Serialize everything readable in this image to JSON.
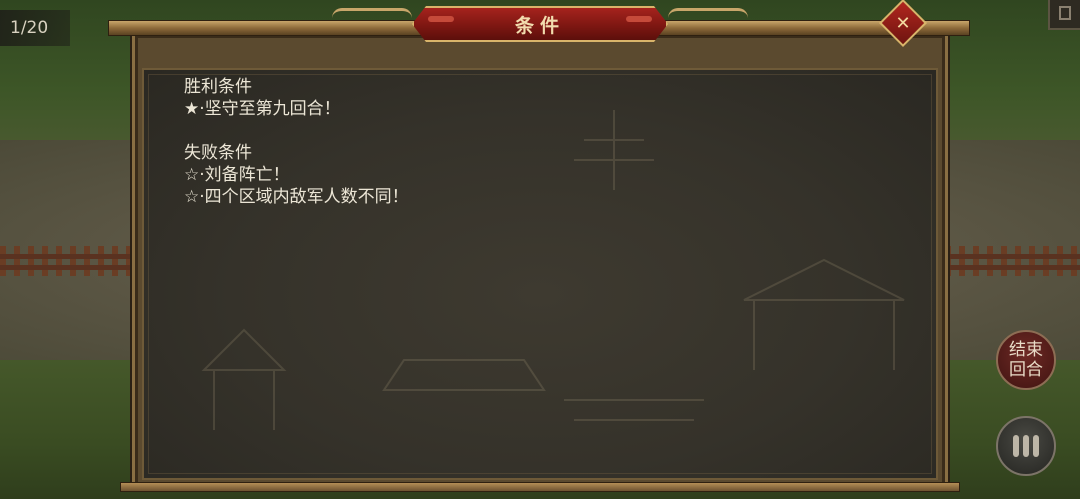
{
  "turn_counter": "1/20",
  "dialog": {
    "title": "条件",
    "victory_heading": "胜利条件",
    "victory_items": [
      "★·坚守至第九回合！"
    ],
    "defeat_heading": "失败条件",
    "defeat_items": [
      "☆·刘备阵亡！",
      "☆·四个区域内敌军人数不同！"
    ]
  },
  "side_buttons": {
    "end_turn_line1": "结束",
    "end_turn_line2": "回合",
    "menu_icon": "menu-bars-icon"
  },
  "icons": {
    "close": "close-icon",
    "corner": "window-icon"
  },
  "colors": {
    "title_red": "#8f1c16",
    "gold_trim": "#d9b46a",
    "panel_bg": "#35322a",
    "text": "#ece6d6"
  }
}
